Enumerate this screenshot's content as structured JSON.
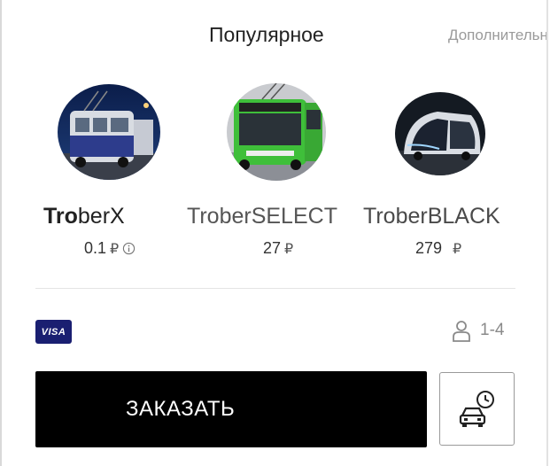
{
  "tabs": {
    "active_label": "Популярное",
    "more_label": "Дополнительно"
  },
  "tariffs": [
    {
      "name_bold": "Tro",
      "name_rest": "berX",
      "price": "0.1",
      "currency": "₽",
      "info_icon": "info-circle-icon",
      "image": "vintage-trolleybus"
    },
    {
      "name_bold": "",
      "name_rest": "TroberSELECT",
      "price": "27",
      "currency": "₽",
      "image": "green-trolleybus"
    },
    {
      "name_bold": "",
      "name_rest": "TroberBLACK",
      "price": "279",
      "currency": "₽",
      "image": "futuristic-bus"
    }
  ],
  "payment": {
    "label": "VISA",
    "color": "#1a1f71"
  },
  "seats": {
    "label": "1-4",
    "icon": "person-icon"
  },
  "order_button": {
    "label": "ЗАКАЗАТЬ"
  },
  "schedule_button": {
    "icon": "car-clock-icon"
  }
}
